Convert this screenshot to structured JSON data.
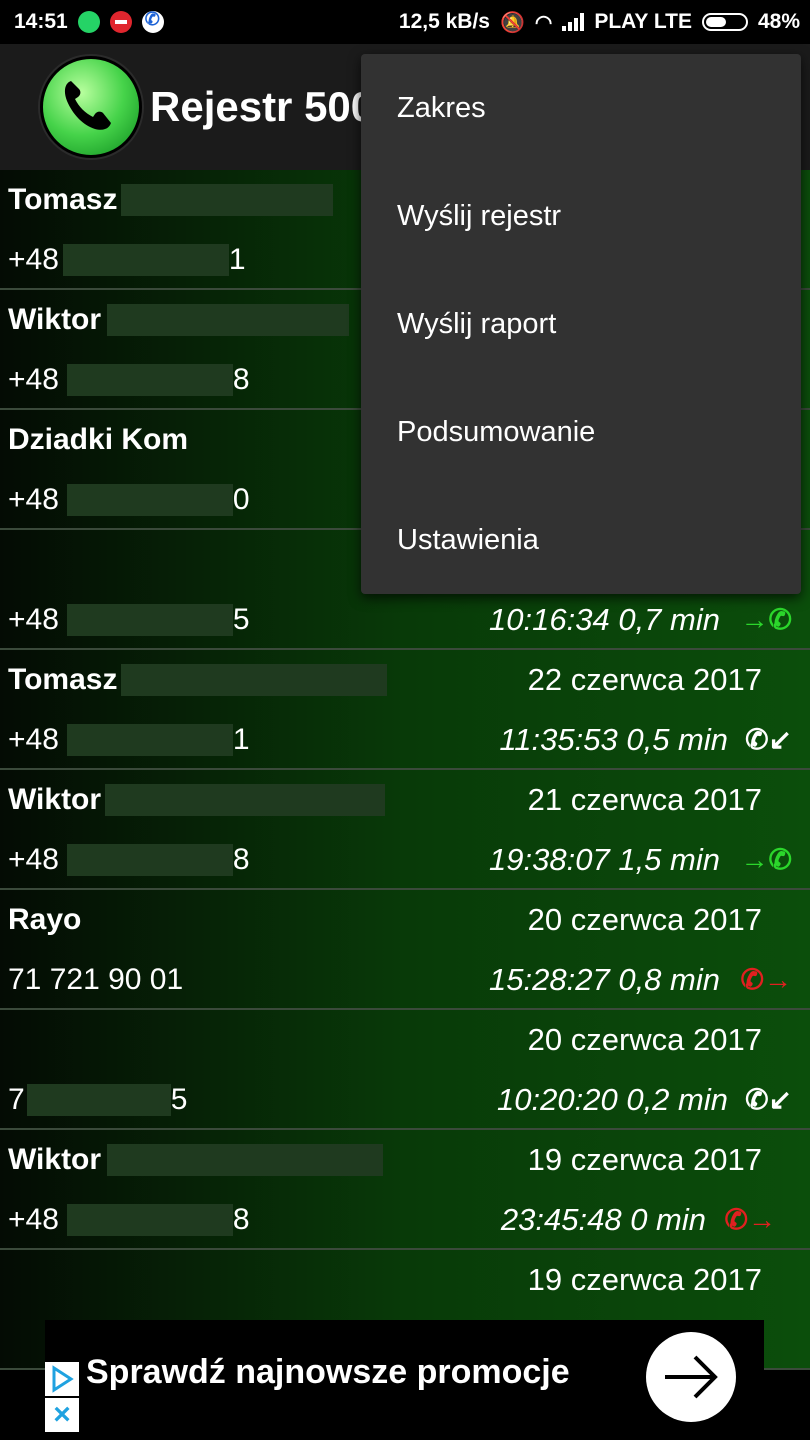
{
  "status_bar": {
    "time": "14:51",
    "net_speed": "12,5 kB/s",
    "carrier": "PLAY LTE",
    "battery": "48%",
    "battery_level": 0.48
  },
  "app_bar": {
    "title": "Rejestr 500"
  },
  "menu": {
    "items": [
      "Zakres",
      "Wyślij rejestr",
      "Wyślij raport",
      "Podsumowanie",
      "Ustawienia"
    ]
  },
  "calls": [
    {
      "name": "Tomasz",
      "number_prefix": "+48",
      "number_suffix": "1",
      "date": "",
      "time": "",
      "direction": ""
    },
    {
      "name": "Wiktor",
      "number_prefix": "+48",
      "number_suffix": "8",
      "date": "",
      "time": "",
      "direction": ""
    },
    {
      "name": "Dziadki Kom",
      "number_prefix": "+48",
      "number_suffix": "0",
      "date": "",
      "time": "",
      "direction": ""
    },
    {
      "name": "",
      "number_prefix": "+48",
      "number_suffix": "5",
      "date": "",
      "time": "10:16:34 0,7 min",
      "direction": "outgoing"
    },
    {
      "name": "Tomasz",
      "number_prefix": "+48",
      "number_suffix": "1",
      "date": "22 czerwca 2017",
      "time": "11:35:53 0,5 min",
      "direction": "incoming"
    },
    {
      "name": "Wiktor",
      "number_prefix": "+48",
      "number_suffix": "8",
      "date": "21 czerwca 2017",
      "time": "19:38:07 1,5 min",
      "direction": "outgoing"
    },
    {
      "name": "Rayo",
      "number_prefix": "71 721 90 01",
      "number_suffix": "",
      "date": "20 czerwca 2017",
      "time": "15:28:27 0,8 min",
      "direction": "missed"
    },
    {
      "name": "",
      "number_prefix": "7",
      "number_suffix": "5",
      "date": "20 czerwca 2017",
      "time": "10:20:20 0,2 min",
      "direction": "incoming"
    },
    {
      "name": "Wiktor",
      "number_prefix": "+48",
      "number_suffix": "8",
      "date": "19 czerwca 2017",
      "time": "23:45:48 0 min",
      "direction": "missed"
    },
    {
      "name": "",
      "number_prefix": "",
      "number_suffix": "",
      "date": "19 czerwca 2017",
      "time": "",
      "direction": ""
    }
  ],
  "ad": {
    "text": "Sprawdź najnowsze promocje"
  },
  "colors": {
    "outgoing": "#2bd62b",
    "missed": "#e02020",
    "incoming": "#ffffff",
    "menu_bg": "#323232",
    "app_bar_bg": "#1b1b1b"
  }
}
